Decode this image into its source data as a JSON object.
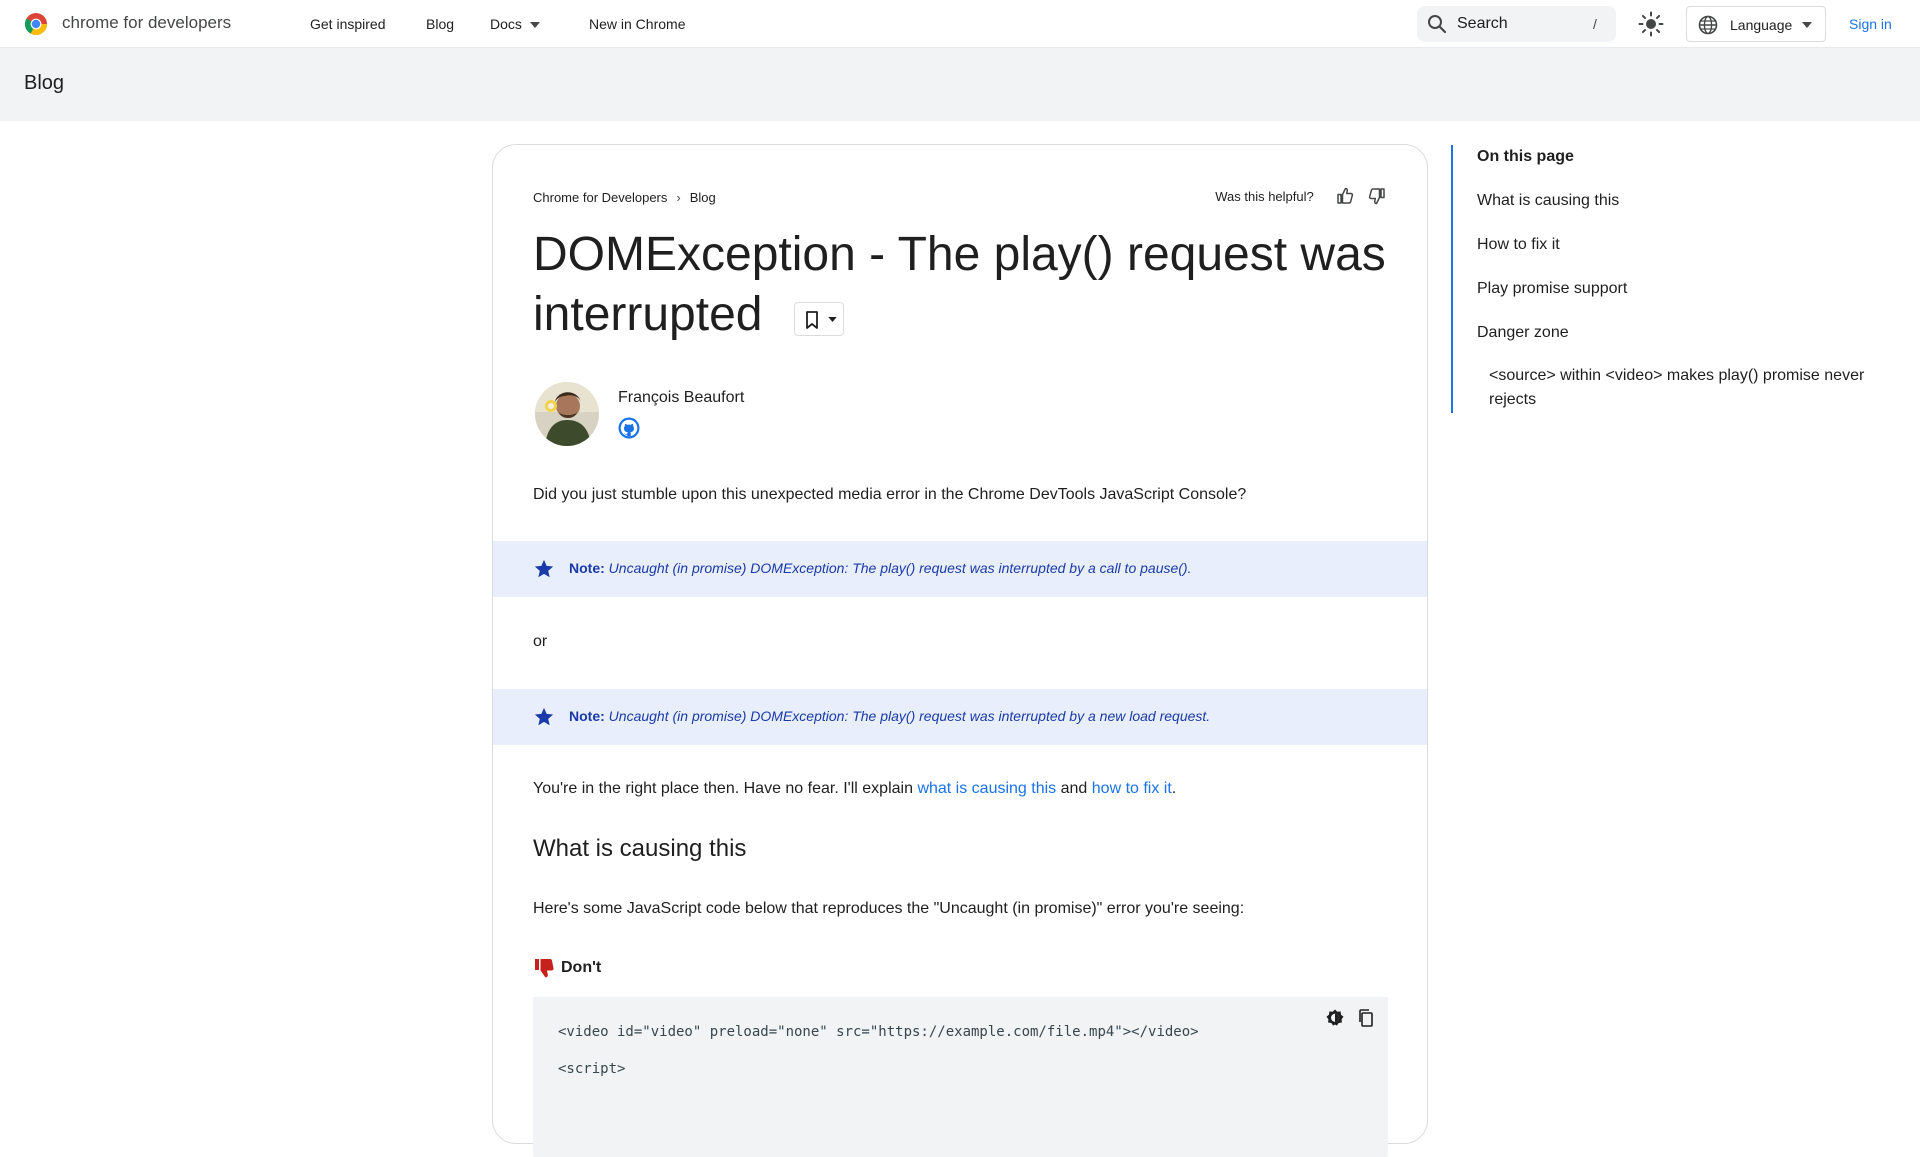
{
  "header": {
    "brand": "chrome for developers",
    "nav": {
      "get_inspired": "Get inspired",
      "blog": "Blog",
      "docs": "Docs",
      "new_in_chrome": "New in Chrome"
    },
    "search": {
      "placeholder": "Search",
      "shortcut": "/"
    },
    "language": "Language",
    "sign_in": "Sign in"
  },
  "subheader": {
    "title": "Blog"
  },
  "article": {
    "breadcrumb": [
      "Chrome for Developers",
      "Blog"
    ],
    "helpful_label": "Was this helpful?",
    "title": "DOMException - The play() request was interrupted",
    "author": {
      "name": "François Beaufort"
    },
    "intro": "Did you just stumble upon this unexpected media error in the Chrome DevTools JavaScript Console?",
    "notes": [
      {
        "label": "Note:",
        "text": "Uncaught (in promise) DOMException: The play() request was interrupted by a call to pause()."
      },
      {
        "label": "Note:",
        "text": "Uncaught (in promise) DOMException: The play() request was interrupted by a new load request."
      }
    ],
    "or_text": "or",
    "reassure": {
      "before": "You're in the right place then. Have no fear. I'll explain ",
      "link1": "what is causing this",
      "middle": " and ",
      "link2": "how to fix it",
      "after": "."
    },
    "section_heading": "What is causing this",
    "section_intro": "Here's some JavaScript code below that reproduces the \"Uncaught (in promise)\" error you're seeing:",
    "dont_label": "Don't",
    "code_lines": [
      "<video id=\"video\" preload=\"none\" src=\"https://example.com/file.mp4\"></video>",
      "<script>"
    ]
  },
  "toc": {
    "title": "On this page",
    "items": [
      "What is causing this",
      "How to fix it",
      "Play promise support",
      "Danger zone",
      "<source> within <video> makes play() promise never rejects"
    ]
  },
  "colors": {
    "link": "#1a73e8",
    "note_background": "#e8eefc",
    "note_text": "#1a3aa8",
    "dont_icon": "#c5221f",
    "subheader_background": "#f1f3f4"
  },
  "icons": {
    "logo": "chrome-logo-icon",
    "search": "search-icon",
    "theme": "sun-icon",
    "language": "globe-icon",
    "note": "star-icon",
    "dont": "thumb-down-icon",
    "code_theme": "contrast-icon",
    "copy": "copy-icon"
  }
}
